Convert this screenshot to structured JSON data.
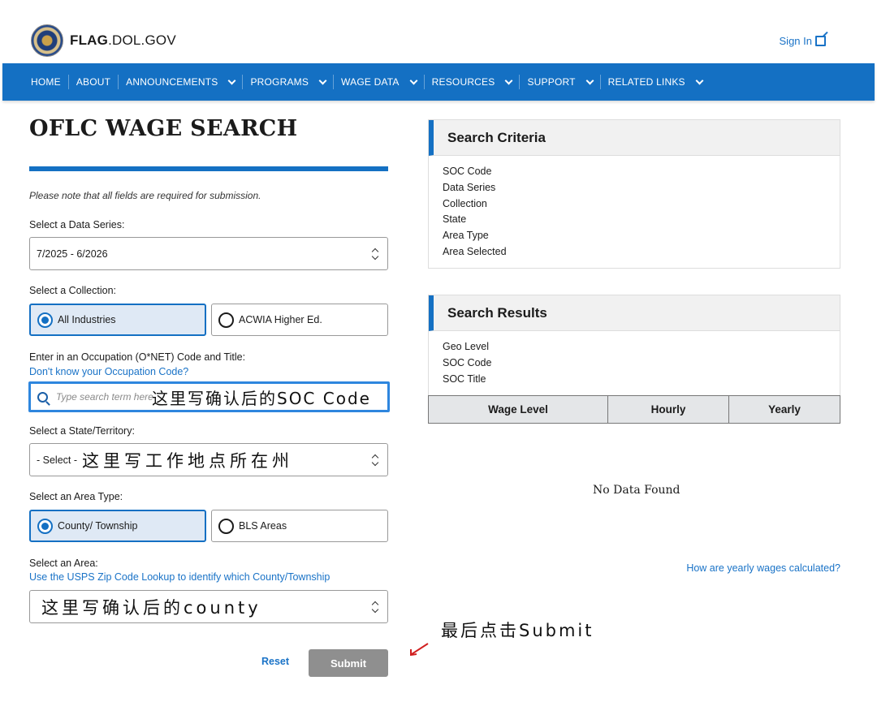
{
  "header": {
    "brand_bold": "FLAG",
    "brand_rest": ".DOL.GOV",
    "signin": "Sign In"
  },
  "nav": [
    {
      "label": "HOME",
      "has_menu": false
    },
    {
      "label": "ABOUT",
      "has_menu": false
    },
    {
      "label": "ANNOUNCEMENTS",
      "has_menu": true
    },
    {
      "label": "PROGRAMS",
      "has_menu": true
    },
    {
      "label": "WAGE DATA",
      "has_menu": true
    },
    {
      "label": "RESOURCES",
      "has_menu": true
    },
    {
      "label": "SUPPORT",
      "has_menu": true
    },
    {
      "label": "RELATED LINKS",
      "has_menu": true
    }
  ],
  "form": {
    "title": "OFLC WAGE SEARCH",
    "note": "Please note that all fields are required for submission.",
    "data_series_label": "Select a Data Series:",
    "data_series_value": "7/2025 - 6/2026",
    "collection_label": "Select a Collection:",
    "collection_options": [
      "All Industries",
      "ACWIA Higher Ed."
    ],
    "occupation_label": "Enter in an Occupation (O*NET) Code and Title:",
    "occupation_link": "Don't know your Occupation Code?",
    "search_placeholder": "Type search term here",
    "state_label": "Select a State/Territory:",
    "state_value": "- Select -",
    "area_type_label": "Select an Area Type:",
    "area_type_options": [
      "County/ Township",
      "BLS Areas"
    ],
    "area_label": "Select an Area:",
    "area_link": "Use the USPS Zip Code Lookup to identify which County/Township",
    "reset": "Reset",
    "submit": "Submit"
  },
  "annotations": {
    "soc": "这里写确认后的SOC Code",
    "state": "这里写工作地点所在州",
    "county": "这里写确认后的county",
    "submit": "最后点击Submit"
  },
  "criteria": {
    "title": "Search Criteria",
    "items": [
      "SOC Code",
      "Data Series",
      "Collection",
      "State",
      "Area Type",
      "Area Selected"
    ]
  },
  "results": {
    "title": "Search Results",
    "items": [
      "Geo Level",
      "SOC Code",
      "SOC Title"
    ],
    "columns": [
      "Wage Level",
      "Hourly",
      "Yearly"
    ],
    "no_data": "No Data Found",
    "yearly_link": "How are yearly wages calculated?"
  },
  "colors": {
    "nav_blue": "#1470c3",
    "link_blue": "#1a73c7",
    "submit_gray": "#8f8f8f"
  }
}
